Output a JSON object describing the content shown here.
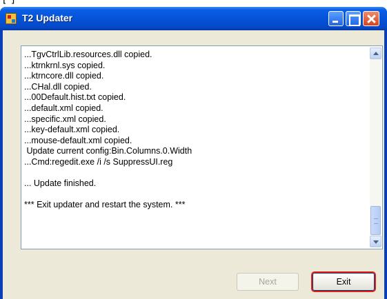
{
  "top_fragment": "[   ]",
  "window": {
    "title": "T2 Updater"
  },
  "log": {
    "lines": [
      "...TgvCtrlLib.resources.dll copied.",
      "...ktrnkrnl.sys copied.",
      "...ktrncore.dll copied.",
      "...CHal.dll copied.",
      "...00Default.hist.txt copied.",
      "...default.xml copied.",
      "...specific.xml copied.",
      "...key-default.xml copied.",
      "...mouse-default.xml copied.",
      " Update current config:Bin.Columns.0.Width",
      "...Cmd:regedit.exe /i /s SuppressUI.reg",
      "",
      "... Update finished.",
      "",
      "*** Exit updater and restart the system. ***"
    ]
  },
  "buttons": {
    "next_label": "Next",
    "exit_label": "Exit"
  },
  "colors": {
    "titlebar": "#0553d8",
    "client_bg": "#ece9d8",
    "highlight": "#e51c1c"
  }
}
